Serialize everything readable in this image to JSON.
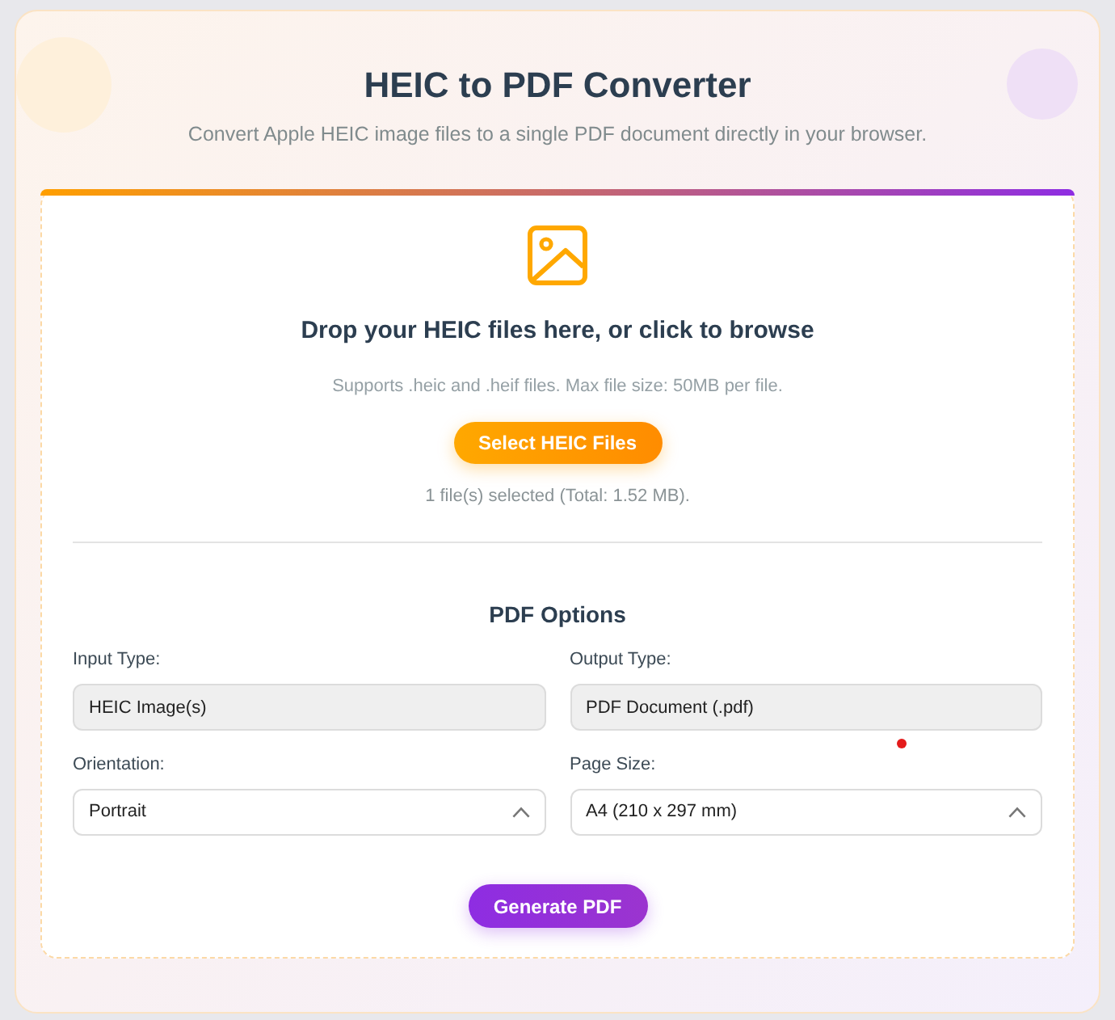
{
  "header": {
    "title": "HEIC to PDF Converter",
    "subtitle": "Convert Apple HEIC image files to a single PDF document directly in your browser."
  },
  "drop_zone": {
    "heading": "Drop your HEIC files here, or click to browse",
    "hint": "Supports .heic and .heif files. Max file size: 50MB per file.",
    "button": "Select HEIC Files",
    "status": "1 file(s) selected (Total: 1.52 MB)."
  },
  "options": {
    "title": "PDF Options",
    "fields": [
      {
        "label": "Input Type:",
        "kind": "readonly",
        "value": "HEIC Image(s)"
      },
      {
        "label": "Output Type:",
        "kind": "readonly",
        "value": "PDF Document (.pdf)"
      },
      {
        "label": "Orientation:",
        "kind": "select",
        "value": "Portrait"
      },
      {
        "label": "Page Size:",
        "kind": "select",
        "value": "A4 (210 x 297 mm)"
      }
    ]
  },
  "generate_button": "Generate PDF"
}
